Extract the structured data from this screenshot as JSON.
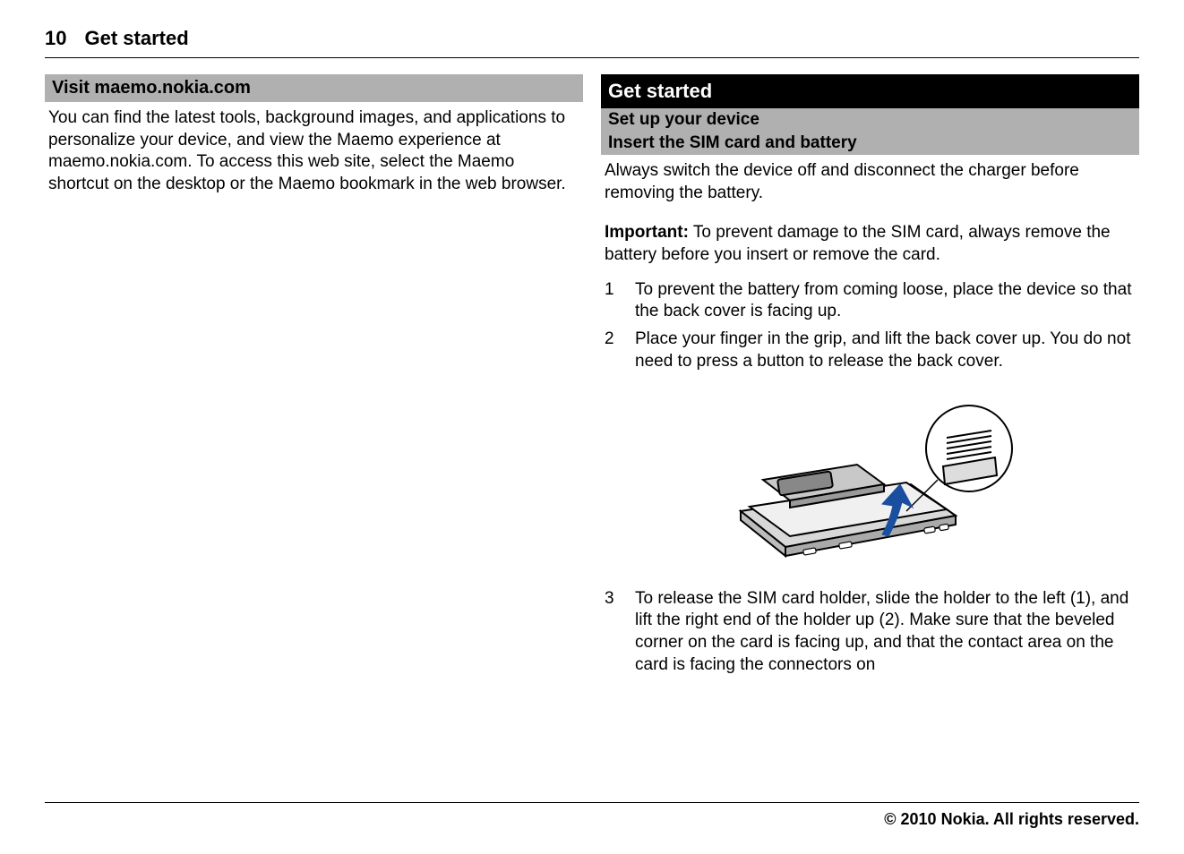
{
  "header": {
    "page_number": "10",
    "title": "Get started"
  },
  "left": {
    "heading": "Visit maemo.nokia.com",
    "paragraph": "You can find the latest tools, background images, and applications to personalize your device, and view the Maemo experience at maemo.nokia.com. To access this web site, select the Maemo shortcut on the desktop or the Maemo bookmark in the web browser."
  },
  "right": {
    "chapter_title": "Get started",
    "section_title": "Set up your device",
    "subsection_title": "Insert the SIM card and battery",
    "intro": "Always switch the device off and disconnect the charger before removing the battery.",
    "important_label": "Important:",
    "important_text": "  To prevent damage to the SIM card, always remove the battery before you insert or remove the card.",
    "steps": [
      "To prevent the battery from coming loose, place the device so that the back cover is facing up.",
      "Place your finger in the grip, and lift the back cover up. You do not need to press a button to release the back cover.",
      "To release the SIM card holder, slide the holder to the left (1), and lift the right end of the holder up (2). Make sure that the beveled corner on the card is facing up, and that the contact area on the card is facing the connectors on"
    ]
  },
  "footer": {
    "copyright": "© 2010 Nokia. All rights reserved."
  }
}
